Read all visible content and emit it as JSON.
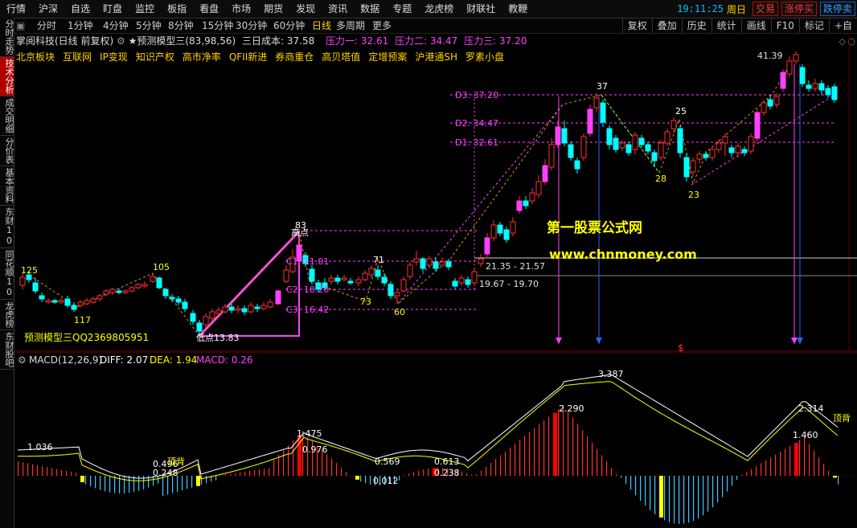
{
  "menu": [
    "行情",
    "沪深",
    "自选",
    "盯盘",
    "监控",
    "板指",
    "看盘",
    "市场",
    "期货",
    "发现",
    "资讯",
    "数据",
    "专题",
    "龙虎榜",
    "财联社",
    "教鞭"
  ],
  "clock": "19:11:25",
  "weekday": "周日",
  "trade_buttons": [
    "交易",
    "涨停买",
    "跌停卖"
  ],
  "sidebar_tabs": [
    "分时走势",
    "技术分析",
    "成交明细",
    "分价表",
    "基本资料",
    "东财10",
    "同花顺10",
    "龙虎榜",
    "东财股吧"
  ],
  "active_sidebar_tab": 1,
  "periods": [
    "分时",
    "1分钟",
    "4分钟",
    "5分钟",
    "8分钟",
    "15分钟",
    "30分钟",
    "60分钟",
    "日线",
    "多周期",
    "更多"
  ],
  "active_period": "日线",
  "right_tools": [
    "复权",
    "叠加",
    "历史",
    "统计",
    "画线",
    "F10",
    "标记",
    "+自"
  ],
  "stock_title": "掌阅科技(日线 前复权)",
  "indicator_label": "★预测模型三(83,98,56)",
  "cost_label": "三日成本: 37.58",
  "pressure": [
    "压力一: 32.61",
    "压力二: 34.47",
    "压力三: 37.20"
  ],
  "concepts": [
    "北京板块",
    "互联网",
    "IP变现",
    "知识产权",
    "高市净率",
    "QFII新进",
    "券商重仓",
    "高贝塔值",
    "定增预案",
    "沪港通SH",
    "罗素小盘"
  ],
  "watermark": {
    "line1": "第一股票公式网",
    "line2": "www.chnmoney.com"
  },
  "model_label": "预测模型三QQ2369805951",
  "price_labels": {
    "d3": "D3: 37.20",
    "d2": "D2: 34.47",
    "d1": "D1: 32.61",
    "c1": "C1: 21.01",
    "c2": "C2: 18.26",
    "c3": "C3: 16.42",
    "band1": "21.35 - 21.57",
    "band2": "19.67 - 19.70",
    "high": "41.39",
    "gaodian": "高点",
    "didian": "低点13.83",
    "n125": "125",
    "n117": "117",
    "n105": "105",
    "n83": "83",
    "n71": "71",
    "n73": "73",
    "n60": "60",
    "n37": "37",
    "n25": "25",
    "n28": "28",
    "n23": "23"
  },
  "macd_header": {
    "name": "MACD(12,26,9)",
    "diff": "DIFF: 2.07",
    "dea": "DEA: 1.94",
    "macd": "MACD: 0.26"
  },
  "macd_labels": {
    "a": "1.036",
    "b": "0.496",
    "b2": "0.248",
    "bei1": "顶背",
    "c": "1.475",
    "d": "0.976",
    "e": "0.569",
    "f": "0.012",
    "g": "0.613",
    "h": "0.238",
    "i": "2.290",
    "j": "3.387",
    "k": "2.314",
    "l": "1.460",
    "bei2": "顶背"
  },
  "colors": {
    "up": "#ff3030",
    "down": "#00ffff",
    "magenta": "#ff40ff",
    "yellow": "#ffff00",
    "accent": "#ffd200",
    "blue": "#3060ff"
  }
}
